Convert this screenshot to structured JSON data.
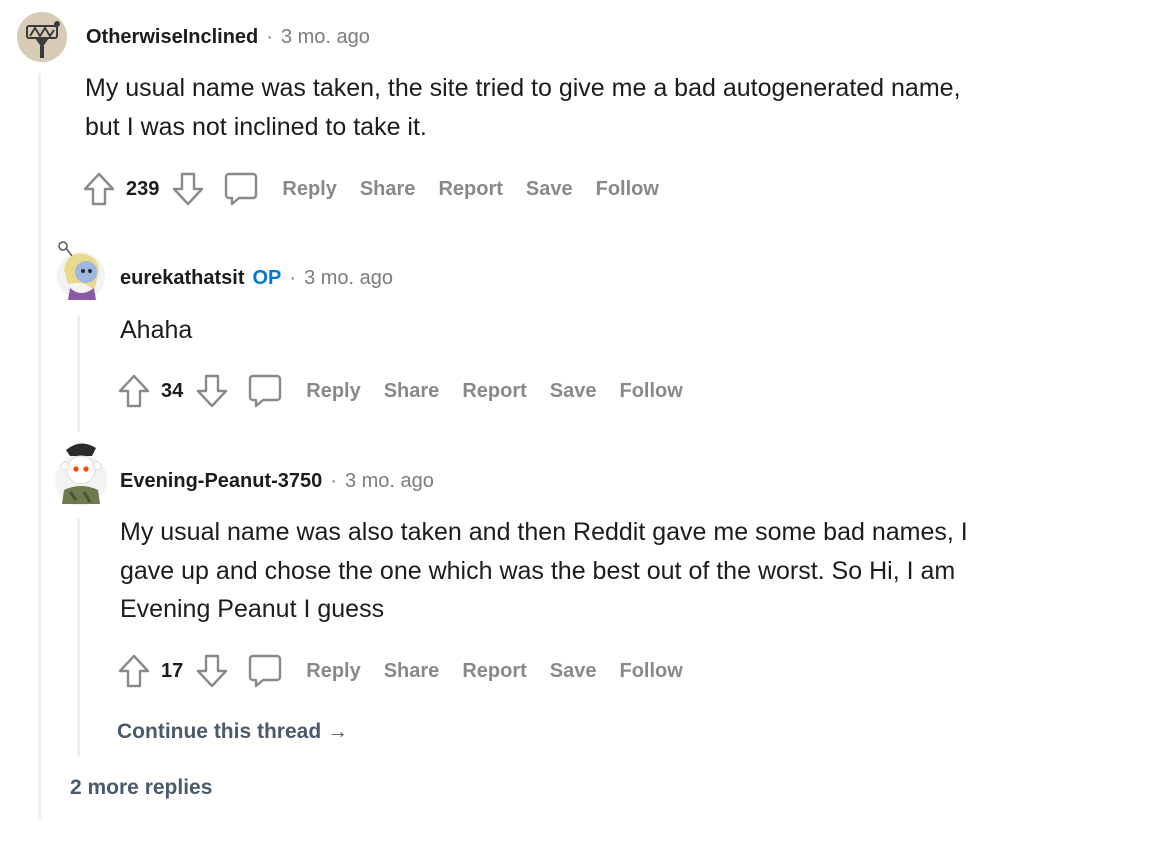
{
  "comments": [
    {
      "username": "OtherwiseInclined",
      "op_badge": "",
      "time": "3 mo. ago",
      "body_lines": [
        "My usual name was taken, the site tried to give me a bad autogenerated name,",
        "but I was not inclined to take it."
      ],
      "score": "239",
      "actions": {
        "reply": "Reply",
        "share": "Share",
        "report": "Report",
        "save": "Save",
        "follow": "Follow"
      }
    },
    {
      "username": "eurekathatsit",
      "op_badge": "OP",
      "time": "3 mo. ago",
      "body_lines": [
        "Ahaha"
      ],
      "score": "34",
      "actions": {
        "reply": "Reply",
        "share": "Share",
        "report": "Report",
        "save": "Save",
        "follow": "Follow"
      }
    },
    {
      "username": "Evening-Peanut-3750",
      "op_badge": "",
      "time": "3 mo. ago",
      "body_lines": [
        "My usual name was also taken and then Reddit gave me some bad names, I",
        "gave up and chose the one which was the best out of the worst. So Hi, I am",
        "Evening Peanut I guess"
      ],
      "score": "17",
      "actions": {
        "reply": "Reply",
        "share": "Share",
        "report": "Report",
        "save": "Save",
        "follow": "Follow"
      }
    }
  ],
  "dot_separator": "·",
  "continue_thread": "Continue this thread →",
  "more_replies": "2 more replies",
  "colors": {
    "accent_op": "#0079d3",
    "muted": "#878a8c",
    "thread_line": "#edeff1",
    "link": "#4b5a6a"
  }
}
